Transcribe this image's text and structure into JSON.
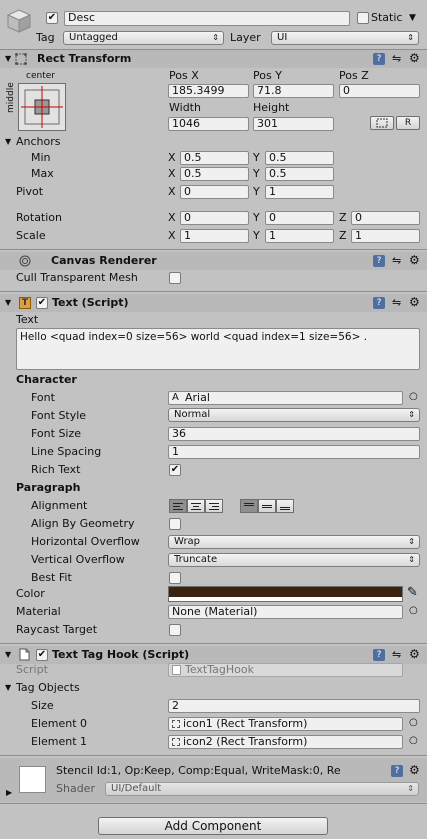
{
  "object": {
    "name": "Desc",
    "static_label": "Static",
    "tag_label": "Tag",
    "tag_value": "Untagged",
    "layer_label": "Layer",
    "layer_value": "UI"
  },
  "rect_transform": {
    "title": "Rect Transform",
    "anchor_preset_top": "center",
    "anchor_preset_side": "middle",
    "pos_x_label": "Pos X",
    "pos_y_label": "Pos Y",
    "pos_z_label": "Pos Z",
    "pos_x": "185.3499",
    "pos_y": "71.8",
    "pos_z": "0",
    "width_label": "Width",
    "height_label": "Height",
    "width": "1046",
    "height": "301",
    "raw_button": "R",
    "anchors_label": "Anchors",
    "min_label": "Min",
    "max_label": "Max",
    "min_x": "0.5",
    "min_y": "0.5",
    "max_x": "0.5",
    "max_y": "0.5",
    "pivot_label": "Pivot",
    "pivot_x": "0",
    "pivot_y": "1",
    "rotation_label": "Rotation",
    "rot_x": "0",
    "rot_y": "0",
    "rot_z": "0",
    "scale_label": "Scale",
    "scale_x": "1",
    "scale_y": "1",
    "scale_z": "1",
    "x": "X",
    "y": "Y",
    "z": "Z"
  },
  "canvas_renderer": {
    "title": "Canvas Renderer",
    "cull_label": "Cull Transparent Mesh",
    "cull_checked": false
  },
  "text_script": {
    "title": "Text (Script)",
    "text_label": "Text",
    "text_value": "Hello <quad index=0 size=56> world <quad index=1 size=56> .",
    "character_label": "Character",
    "font_label": "Font",
    "font_value": "Arial",
    "font_style_label": "Font Style",
    "font_style_value": "Normal",
    "font_size_label": "Font Size",
    "font_size_value": "36",
    "line_spacing_label": "Line Spacing",
    "line_spacing_value": "1",
    "rich_text_label": "Rich Text",
    "rich_text_checked": true,
    "paragraph_label": "Paragraph",
    "alignment_label": "Alignment",
    "align_by_geometry_label": "Align By Geometry",
    "horizontal_overflow_label": "Horizontal Overflow",
    "horizontal_overflow_value": "Wrap",
    "vertical_overflow_label": "Vertical Overflow",
    "vertical_overflow_value": "Truncate",
    "best_fit_label": "Best Fit",
    "color_label": "Color",
    "color_value": "#3a2410",
    "material_label": "Material",
    "material_value": "None (Material)",
    "raycast_label": "Raycast Target"
  },
  "text_tag_hook": {
    "title": "Text Tag Hook (Script)",
    "script_label": "Script",
    "script_value": "TextTagHook",
    "tag_objects_label": "Tag Objects",
    "size_label": "Size",
    "size_value": "2",
    "element0_label": "Element 0",
    "element0_value": "icon1 (Rect Transform)",
    "element1_label": "Element 1",
    "element1_value": "icon2 (Rect Transform)"
  },
  "material_section": {
    "title": "Stencil Id:1, Op:Keep, Comp:Equal, WriteMask:0, Re",
    "shader_label": "Shader",
    "shader_value": "UI/Default"
  },
  "add_component_label": "Add Component",
  "icons": {
    "check": "✔",
    "arrow_down": "▼",
    "arrow_right": "▶",
    "updown": "⇕",
    "gear": "⚙",
    "help": "?",
    "settings_slider": "⇋",
    "circle": "○",
    "eyedropper": "✎"
  }
}
